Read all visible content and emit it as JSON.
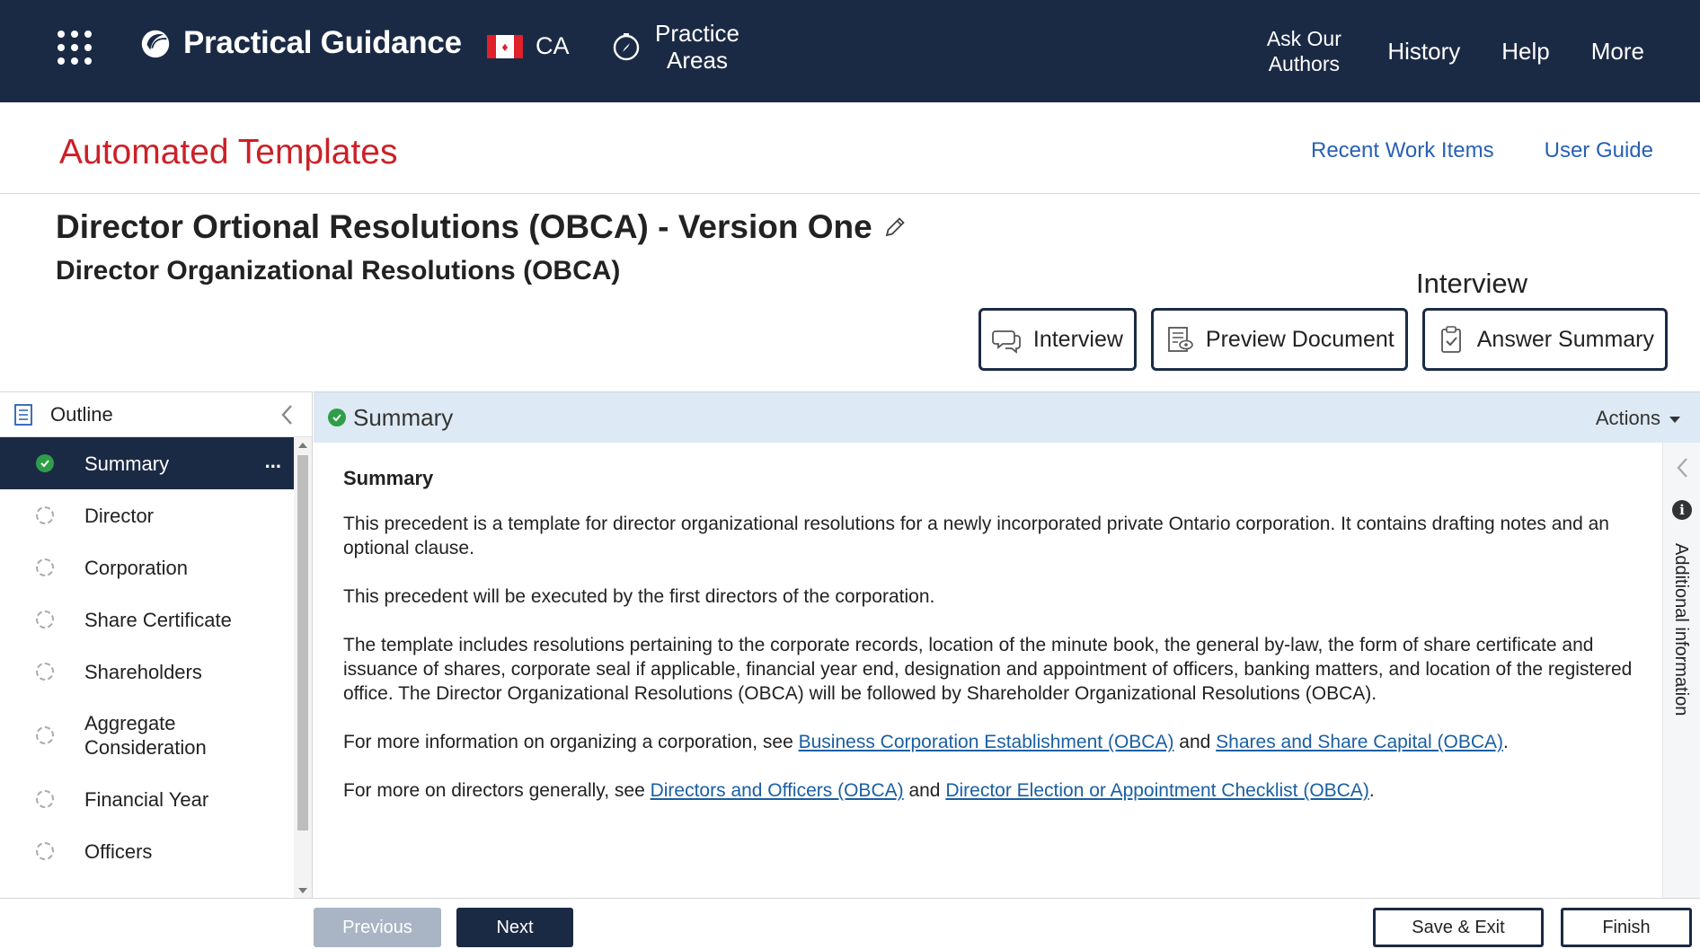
{
  "nav": {
    "brand": "Practical Guidance",
    "region": "CA",
    "practice_areas": "Practice Areas",
    "links": [
      "Ask Our Authors",
      "History",
      "Help",
      "More"
    ],
    "icons": [
      "apps-grid-icon",
      "practical-guidance-logo-icon",
      "canada-flag-icon",
      "compass-icon"
    ]
  },
  "header": {
    "title": "Automated Templates",
    "recent_work_items": "Recent Work Items",
    "user_guide": "User Guide"
  },
  "document": {
    "title": "Director Ortional Resolutions (OBCA) - Version One",
    "subtitle": "Director Organizational Resolutions (OBCA)",
    "mode_label": "Interview",
    "modes": {
      "interview": "Interview",
      "preview": "Preview Document",
      "summary": "Answer Summary"
    }
  },
  "outline": {
    "title": "Outline",
    "items": [
      {
        "label": "Summary",
        "status": "complete",
        "active": true
      },
      {
        "label": "Director",
        "status": "pending"
      },
      {
        "label": "Corporation",
        "status": "pending"
      },
      {
        "label": "Share Certificate",
        "status": "pending"
      },
      {
        "label": "Shareholders",
        "status": "pending"
      },
      {
        "label": "Aggregate Consideration",
        "status": "pending"
      },
      {
        "label": "Financial Year",
        "status": "pending"
      },
      {
        "label": "Officers",
        "status": "pending"
      }
    ],
    "more_label": "..."
  },
  "content": {
    "section_title": "Summary",
    "actions_label": "Actions",
    "heading": "Summary",
    "p1": "This precedent is a template for director organizational resolutions for a newly incorporated private Ontario corporation. It contains drafting notes and an optional clause.",
    "p2": "This precedent will be executed by the first directors of the corporation.",
    "p3": "The template includes resolutions pertaining to the corporate records, location of the minute book, the general by-law, the form of share certificate and issuance of shares, corporate seal if applicable, financial year end, designation and appointment of officers, banking matters, and location of the registered office. The Director Organizational Resolutions (OBCA) will be followed by Shareholder Organizational Resolutions (OBCA).",
    "p4_prefix": "For more information on organizing a corporation, see ",
    "p4_link1": "Business Corporation Establishment (OBCA)",
    "p4_mid": " and ",
    "p4_link2": "Shares and Share Capital (OBCA)",
    "p4_suffix": ".",
    "p5_prefix": "For more on directors generally, see ",
    "p5_link1": "Directors and Officers (OBCA)",
    "p5_mid": " and ",
    "p5_link2": "Director Election or Appointment Checklist (OBCA)",
    "p5_suffix": ".",
    "side_panel_label": "Additional information",
    "info_glyph": "i"
  },
  "footer": {
    "previous": "Previous",
    "next": "Next",
    "save_exit": "Save & Exit",
    "finish": "Finish"
  },
  "colors": {
    "nav_bg": "#1b2a44",
    "title_red": "#cc2027",
    "link_blue": "#2760b5",
    "complete_green": "#2e9e48",
    "content_header_bg": "#dde9f4"
  }
}
